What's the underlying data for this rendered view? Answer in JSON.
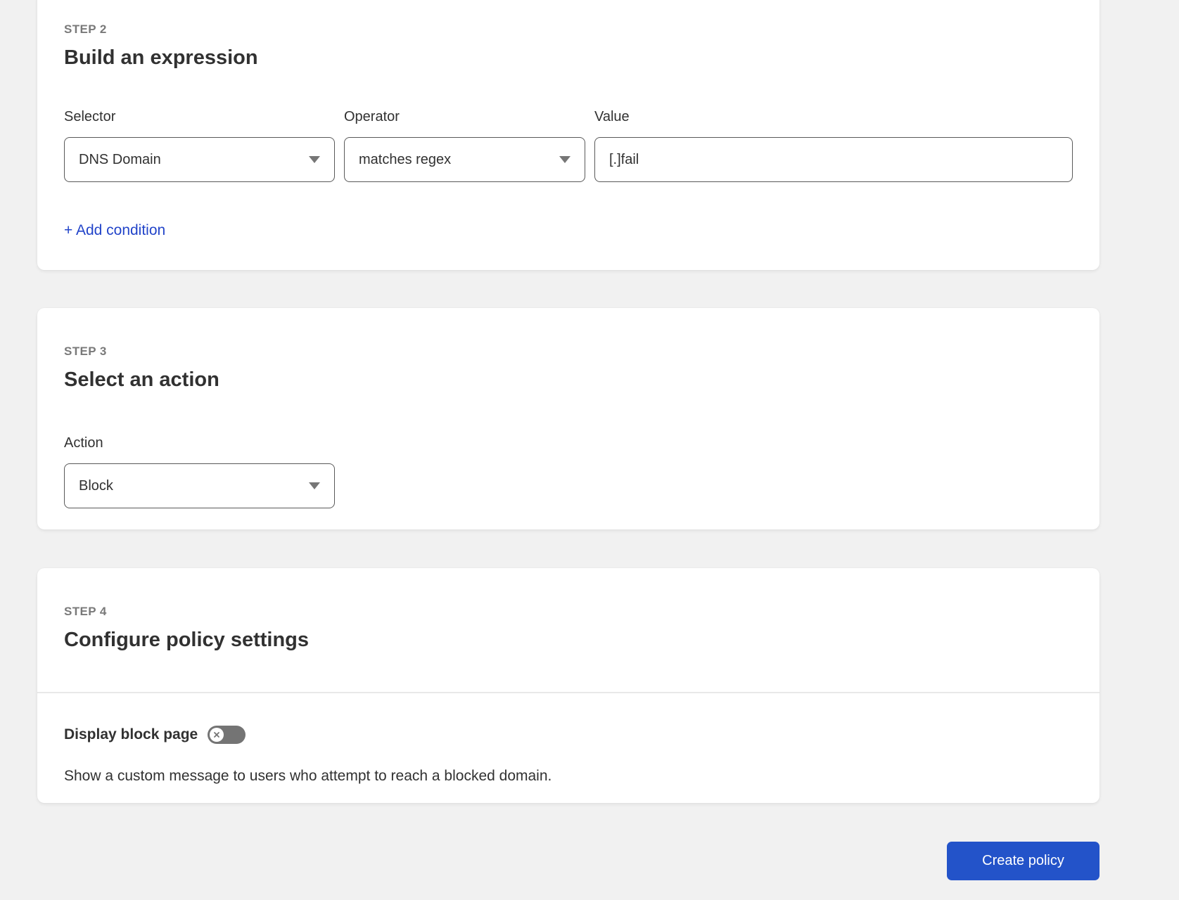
{
  "colors": {
    "page_background": "#f1f1f1",
    "card_background": "#ffffff",
    "accent_button_blue": "#2353c9",
    "link_blue": "#2244c9",
    "field_border_gray": "#595959",
    "toggle_off_gray": "#747474",
    "eyebrow_gray": "#797979",
    "text_dark": "#313131"
  },
  "steps": {
    "step2": {
      "eyebrow": "STEP 2",
      "title": "Build an expression",
      "fields": [
        {
          "label": "Selector",
          "type": "select",
          "value": "DNS Domain"
        },
        {
          "label": "Operator",
          "type": "select",
          "value": "matches regex"
        },
        {
          "label": "Value",
          "type": "input",
          "value": "[.]fail"
        }
      ],
      "add_condition_label": "+ Add condition"
    },
    "step3": {
      "eyebrow": "STEP 3",
      "title": "Select an action",
      "action_label": "Action",
      "action_value": "Block"
    },
    "step4": {
      "eyebrow": "STEP 4",
      "title": "Configure policy settings",
      "toggle_label": "Display block page",
      "toggle_state": "off",
      "description": "Show a custom message to users who attempt to reach a blocked domain."
    }
  },
  "footer": {
    "create_button_label": "Create policy"
  }
}
